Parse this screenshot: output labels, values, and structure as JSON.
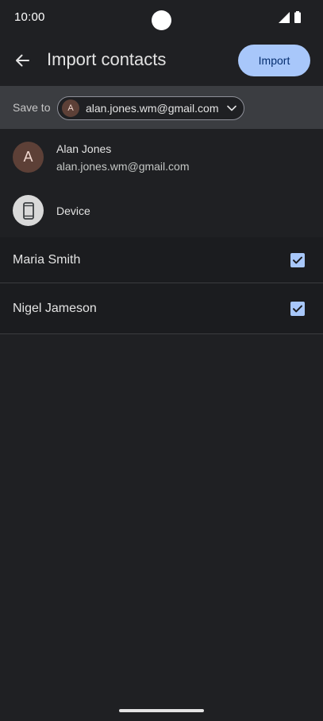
{
  "status_bar": {
    "time": "10:00"
  },
  "app_bar": {
    "title": "Import contacts",
    "import_label": "Import",
    "accent_color": "#a8c7fa"
  },
  "save_bar": {
    "label": "Save to",
    "account_initial": "A",
    "account_email": "alan.jones.wm@gmail.com"
  },
  "account": {
    "initial": "A",
    "name": "Alan Jones",
    "email": "alan.jones.wm@gmail.com"
  },
  "device": {
    "label": "Device",
    "icon": "phone-icon"
  },
  "contacts": [
    {
      "name": "Maria Smith",
      "checked": true
    },
    {
      "name": "Nigel Jameson",
      "checked": true
    }
  ]
}
